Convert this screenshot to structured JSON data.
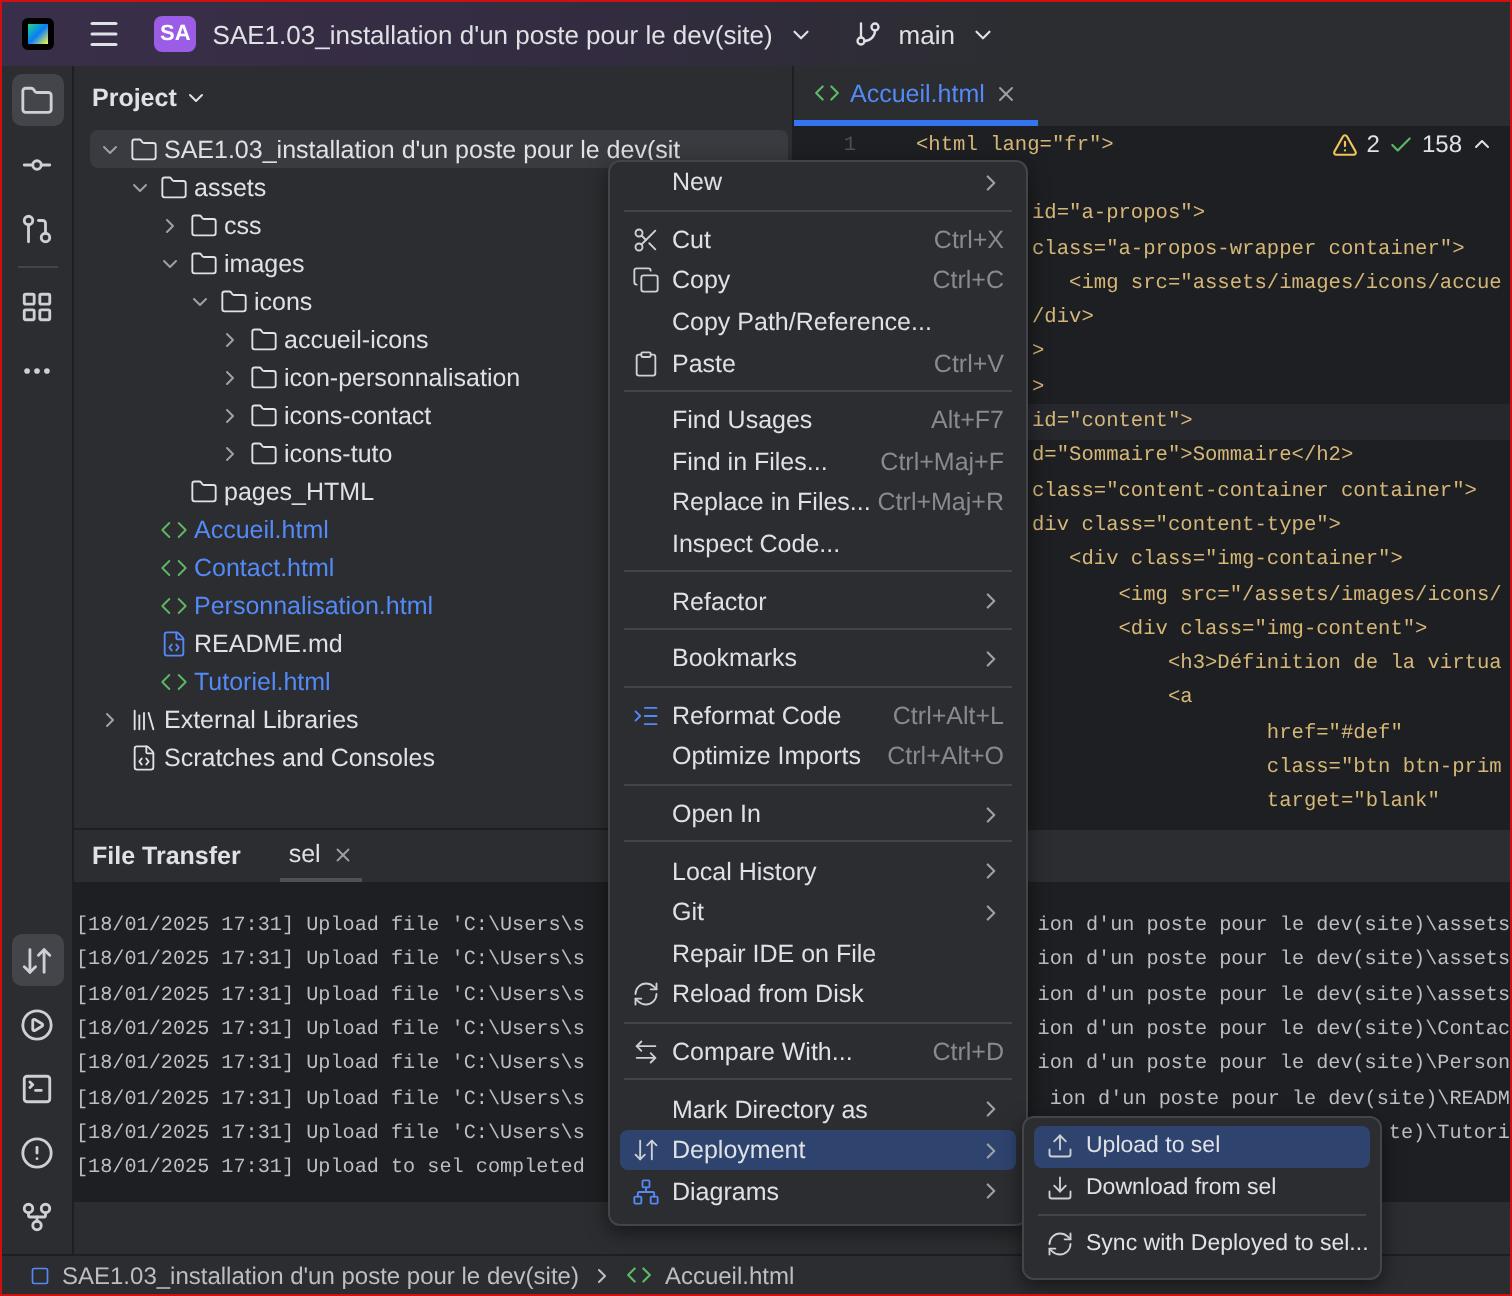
{
  "title_bar": {
    "badge": "SA",
    "project": "SAE1.03_installation d'un poste pour le dev(site)",
    "branch": "main"
  },
  "project_panel": {
    "title": "Project",
    "tree": [
      {
        "label": "SAE1.03_installation d'un poste pour le dev(sit",
        "kind": "folder",
        "expanded": true,
        "selected": true,
        "children": [
          {
            "label": "assets",
            "kind": "folder",
            "expanded": true,
            "selected": false,
            "children": [
              {
                "label": "css",
                "kind": "folder",
                "expanded": false,
                "selected": false
              },
              {
                "label": "images",
                "kind": "folder",
                "expanded": true,
                "selected": false,
                "children": [
                  {
                    "label": "icons",
                    "kind": "folder",
                    "expanded": true,
                    "selected": false,
                    "children": [
                      {
                        "label": "accueil-icons",
                        "kind": "folder",
                        "expanded": false,
                        "selected": false
                      },
                      {
                        "label": "icon-personnalisation",
                        "kind": "folder",
                        "expanded": false,
                        "selected": false
                      },
                      {
                        "label": "icons-contact",
                        "kind": "folder",
                        "expanded": false,
                        "selected": false
                      },
                      {
                        "label": "icons-tuto",
                        "kind": "folder",
                        "expanded": false,
                        "selected": false
                      }
                    ]
                  }
                ]
              },
              {
                "label": "pages_HTML",
                "kind": "folder",
                "selected": false
              }
            ]
          },
          {
            "label": "Accueil.html",
            "kind": "html",
            "selected": false
          },
          {
            "label": "Contact.html",
            "kind": "html",
            "selected": false
          },
          {
            "label": "Personnalisation.html",
            "kind": "html",
            "selected": false
          },
          {
            "label": "README.md",
            "kind": "markdown",
            "selected": false
          },
          {
            "label": "Tutoriel.html",
            "kind": "html",
            "selected": false
          }
        ]
      },
      {
        "label": "External Libraries",
        "kind": "library",
        "expanded": false,
        "selected": false
      },
      {
        "label": "Scratches and Consoles",
        "kind": "scratches",
        "selected": false
      }
    ]
  },
  "editor": {
    "tabs": [
      {
        "label": "Accueil.html",
        "selected": true
      }
    ],
    "warnings": "2",
    "passed": "158",
    "lines": [
      {
        "number": "1",
        "text": "<html lang=\"fr\">",
        "current": false
      },
      {
        "current": false
      },
      {
        "text": "id=\"a-propos\">",
        "current": false
      },
      {
        "text": "class=\"a-propos-wrapper container\">",
        "current": false
      },
      {
        "text": "   <img src=\"assets/images/icons/accue",
        "current": false
      },
      {
        "text": "/div>",
        "current": false
      },
      {
        "text": ">",
        "current": false
      },
      {
        "text": ">",
        "current": false
      },
      {
        "text": "id=\"content\">",
        "current": true
      },
      {
        "text": "d=\"Sommaire\">Sommaire</h2>",
        "current": false
      },
      {
        "text": "class=\"content-container container\">",
        "current": false
      },
      {
        "text": "div class=\"content-type\">",
        "current": false
      },
      {
        "text": "   <div class=\"img-container\">",
        "current": false
      },
      {
        "text": "       <img src=\"/assets/images/icons/",
        "current": false
      },
      {
        "text": "       <div class=\"img-content\">",
        "current": false
      },
      {
        "text": "           <h3>Définition de la virtua",
        "current": false
      },
      {
        "text": "           <a",
        "current": false
      },
      {
        "text": "                   href=\"#def\"",
        "current": false
      },
      {
        "text": "                   class=\"btn btn-prim",
        "current": false
      },
      {
        "text": "                   target=\"blank\"",
        "current": false
      }
    ]
  },
  "bottom_panel": {
    "title": "File Transfer",
    "tabs": [
      {
        "label": "sel",
        "selected": true
      }
    ],
    "log": [
      {
        "left": "[18/01/2025 17:31] Upload file 'C:\\Users\\s",
        "right": "ion d'un poste pour le dev(site)\\assets"
      },
      {
        "left": "[18/01/2025 17:31] Upload file 'C:\\Users\\s",
        "right": "ion d'un poste pour le dev(site)\\assets"
      },
      {
        "left": "[18/01/2025 17:31] Upload file 'C:\\Users\\s",
        "right": "ion d'un poste pour le dev(site)\\assets"
      },
      {
        "left": "[18/01/2025 17:31] Upload file 'C:\\Users\\s",
        "right": "ion d'un poste pour le dev(site)\\Contac"
      },
      {
        "left": "[18/01/2025 17:31] Upload file 'C:\\Users\\s",
        "right": "ion d'un poste pour le dev(site)\\Person"
      },
      {
        "left": "[18/01/2025 17:31] Upload file 'C:\\Users\\s",
        "right": "ion d'un poste pour le dev(site)\\READM"
      },
      {
        "left": "[18/01/2025 17:31] Upload file 'C:\\Users\\s",
        "right": "te)\\Tutori"
      },
      {
        "left": "[18/01/2025 17:31] Upload to sel completed"
      }
    ]
  },
  "context_menu": {
    "items": [
      {
        "kind": "item",
        "label": "New",
        "submenu": true,
        "selected": false
      },
      {
        "kind": "separator"
      },
      {
        "kind": "item",
        "label": "Cut",
        "shortcut": "Ctrl+X",
        "selected": false
      },
      {
        "kind": "item",
        "label": "Copy",
        "shortcut": "Ctrl+C",
        "selected": false
      },
      {
        "kind": "item",
        "label": "Copy Path/Reference...",
        "selected": false
      },
      {
        "kind": "item",
        "label": "Paste",
        "shortcut": "Ctrl+V",
        "selected": false
      },
      {
        "kind": "separator"
      },
      {
        "kind": "item",
        "label": "Find Usages",
        "shortcut": "Alt+F7",
        "selected": false
      },
      {
        "kind": "item",
        "label": "Find in Files...",
        "shortcut": "Ctrl+Maj+F",
        "selected": false
      },
      {
        "kind": "item",
        "label": "Replace in Files...",
        "shortcut": "Ctrl+Maj+R",
        "selected": false
      },
      {
        "kind": "item",
        "label": "Inspect Code...",
        "selected": false
      },
      {
        "kind": "separator"
      },
      {
        "kind": "item",
        "label": "Refactor",
        "submenu": true,
        "selected": false
      },
      {
        "kind": "separator"
      },
      {
        "kind": "item",
        "label": "Bookmarks",
        "submenu": true,
        "selected": false
      },
      {
        "kind": "separator"
      },
      {
        "kind": "item",
        "label": "Reformat Code",
        "shortcut": "Ctrl+Alt+L",
        "selected": false
      },
      {
        "kind": "item",
        "label": "Optimize Imports",
        "shortcut": "Ctrl+Alt+O",
        "selected": false
      },
      {
        "kind": "separator"
      },
      {
        "kind": "item",
        "label": "Open In",
        "submenu": true,
        "selected": false
      },
      {
        "kind": "separator"
      },
      {
        "kind": "item",
        "label": "Local History",
        "submenu": true,
        "selected": false
      },
      {
        "kind": "item",
        "label": "Git",
        "submenu": true,
        "selected": false
      },
      {
        "kind": "item",
        "label": "Repair IDE on File",
        "selected": false
      },
      {
        "kind": "item",
        "label": "Reload from Disk",
        "selected": false
      },
      {
        "kind": "separator"
      },
      {
        "kind": "item",
        "label": "Compare With...",
        "shortcut": "Ctrl+D",
        "selected": false
      },
      {
        "kind": "separator"
      },
      {
        "kind": "item",
        "label": "Mark Directory as",
        "submenu": true,
        "selected": false
      },
      {
        "kind": "item",
        "label": "Deployment",
        "submenu": true,
        "selected": true
      },
      {
        "kind": "item",
        "label": "Diagrams",
        "submenu": true,
        "selected": false
      }
    ]
  },
  "submenu": {
    "items": [
      {
        "kind": "item",
        "label": "Upload to sel",
        "selected": true
      },
      {
        "kind": "item",
        "label": "Download from sel",
        "selected": false
      },
      {
        "kind": "separator"
      },
      {
        "kind": "item",
        "label": "Sync with Deployed to sel...",
        "selected": false
      }
    ]
  },
  "status_bar": {
    "project": "SAE1.03_installation d'un poste pour le dev(site)",
    "file": "Accueil.html"
  }
}
